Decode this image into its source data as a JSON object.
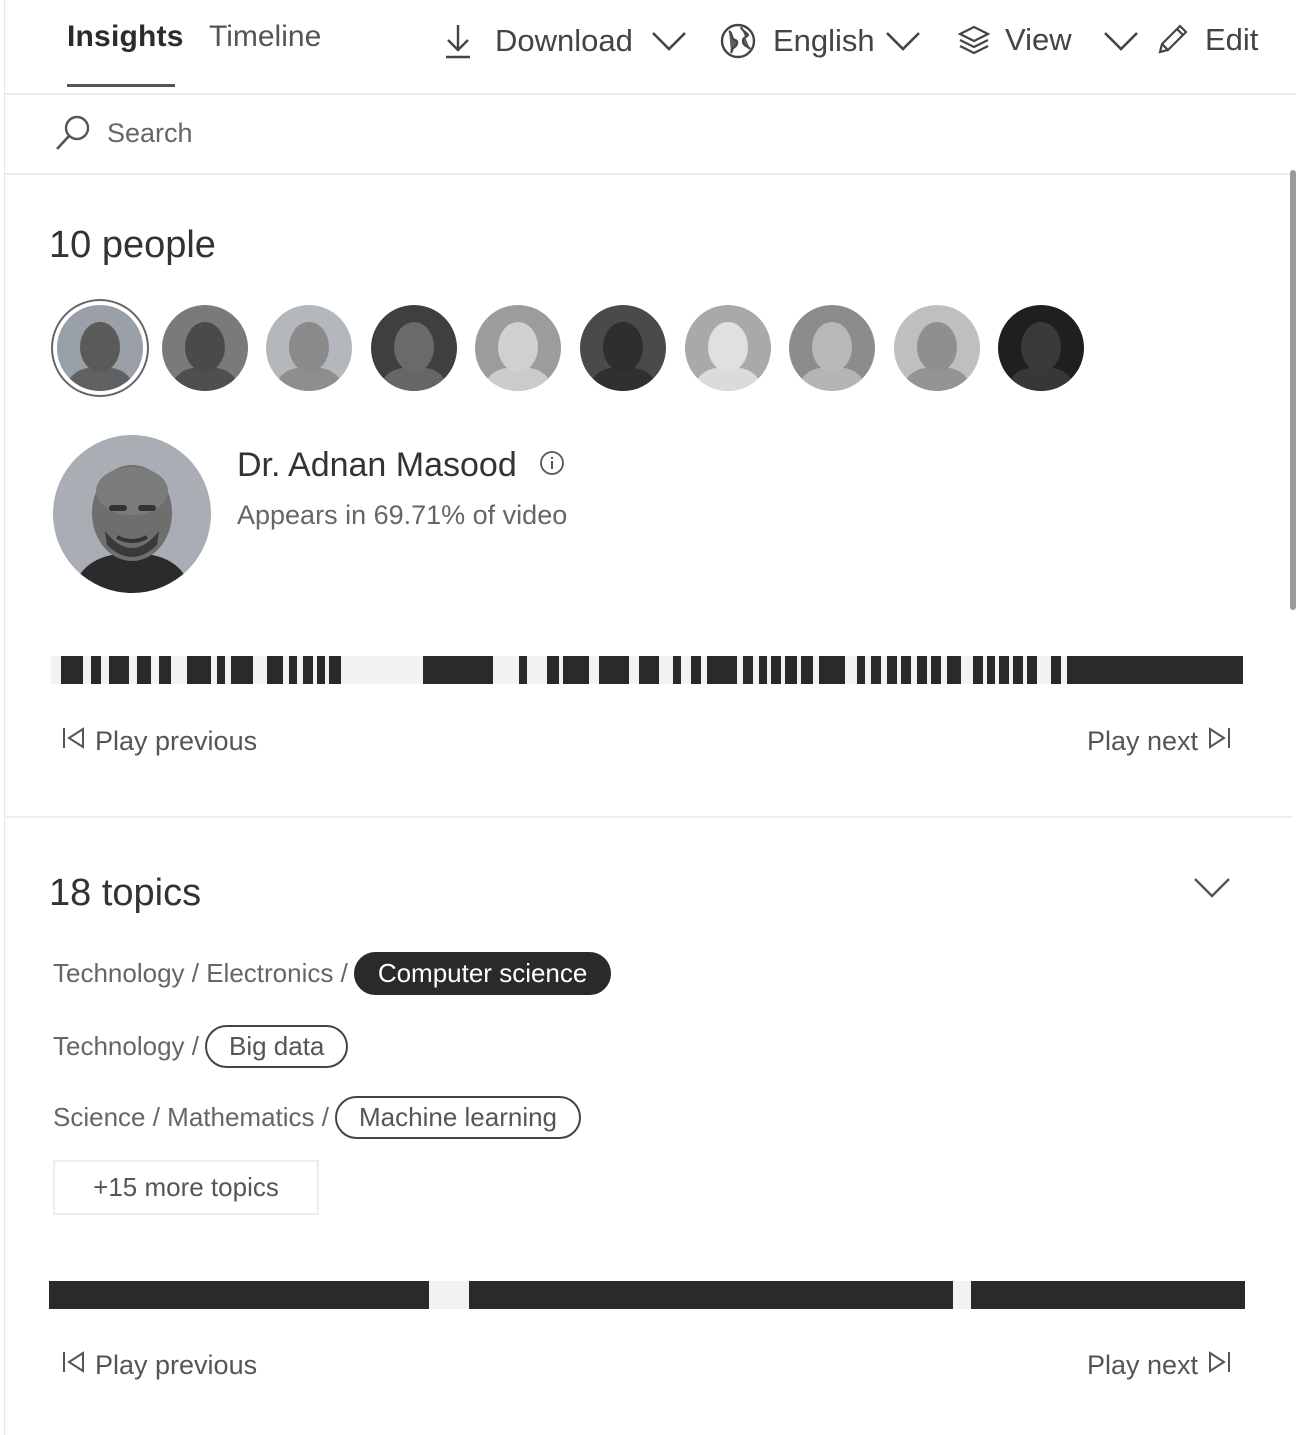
{
  "tabs": {
    "insights": "Insights",
    "timeline": "Timeline"
  },
  "toolbar": {
    "download": "Download",
    "language": "English",
    "view": "View",
    "edit": "Edit"
  },
  "search": {
    "placeholder": "Search"
  },
  "people": {
    "title": "10 people",
    "avatars": [
      "person-1",
      "person-2",
      "person-3",
      "person-4",
      "person-5",
      "person-6",
      "person-7",
      "person-8",
      "person-9",
      "person-10"
    ],
    "selected": {
      "name": "Dr. Adnan Masood",
      "appears": "Appears in 69.71% of video"
    },
    "nav": {
      "previous": "Play previous",
      "next": "Play next"
    }
  },
  "topics": {
    "title": "18 topics",
    "items": [
      {
        "path": "Technology / Electronics /",
        "label": "Computer science",
        "selected": true
      },
      {
        "path": "Technology /",
        "label": "Big data",
        "selected": false
      },
      {
        "path": "Science / Mathematics /",
        "label": "Machine learning",
        "selected": false
      }
    ],
    "more": "+15 more topics",
    "nav": {
      "previous": "Play previous",
      "next": "Play next"
    }
  },
  "colors": {
    "accent_dark": "#2a2a2a",
    "divider": "#ececec",
    "text": "#333333"
  }
}
